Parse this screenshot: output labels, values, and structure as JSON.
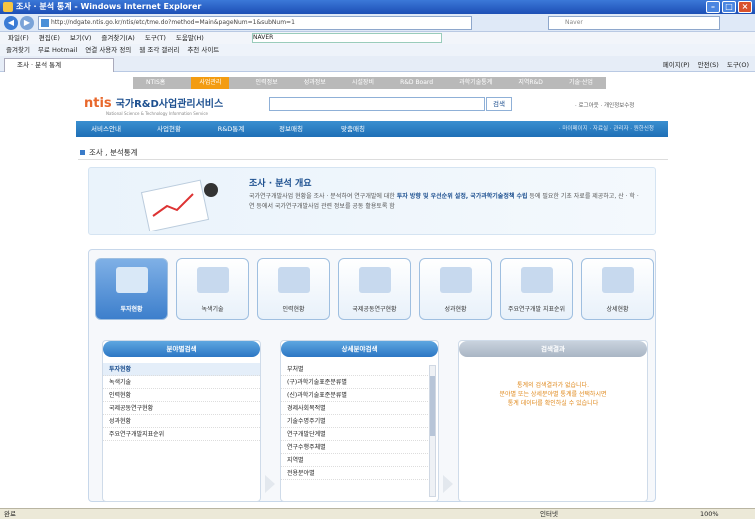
{
  "window": {
    "title": "조사 · 분석 통계 - Windows Internet Explorer"
  },
  "browser": {
    "url": "http://ndgate.ntis.go.kr/ntis/etc/tme.do?method=Main&pageNum=1&subNum=1",
    "search_placeholder": "Naver",
    "menu": [
      "파일(F)",
      "편집(E)",
      "보기(V)",
      "즐겨찾기(A)",
      "도구(T)",
      "도움말(H)"
    ],
    "zum_box": "NAVER",
    "fav_items": [
      "즐겨찾기",
      "무료 Hotmail",
      "연결 사용자 정의",
      "웹 조각 갤러리",
      "추천 사이트"
    ],
    "tab_title": "조사 · 분석 통계",
    "right_tools": [
      "페이지(P)",
      "안전(S)",
      "도구(O)"
    ],
    "status": "완료",
    "zone": "인터넷",
    "zoom": "100%"
  },
  "site": {
    "top_menu": [
      "NTIS홈",
      "사업관리",
      "인력정보",
      "성과정보",
      "시설장비",
      "R&D Board",
      "과학기술통계",
      "지역R&D",
      "기술·산업"
    ],
    "logo": "국가R&D사업관리서비스",
    "logo_sub": "National Science & Technology Information Service",
    "search_button": "검색",
    "util_links": "· 로그아웃 · 개인정보수정",
    "gnb": [
      "서비스안내",
      "사업현황",
      "R&D통계",
      "정보매칭",
      "맞춤매칭"
    ],
    "gnb_right": "· 마이페이지 · 자료실 · 관리자 · 원한신청",
    "page_title": "조사 , 분석통계",
    "overview_title": "조사 · 분석 개요",
    "overview_text_1": "국가연구개발사업 현황을 조사 · 분석하여 연구개발에 대한",
    "overview_bold": "투자 방향 및 우선순위 설정, 국가과학기술정책 수립",
    "overview_text_2": "등에 필요한 기초 자료를 제공하고, 산 · 학 · 연 등에서 국가연구개발사업 관련 정보를 공동 활용토록 함",
    "cards": [
      "투자현황",
      "녹색기술",
      "인력현황",
      "국제공동연구현황",
      "성과현황",
      "주요연구개발 지표순위",
      "상세현황"
    ],
    "col1_head": "분야별검색",
    "col1_items": [
      "투자현황",
      "녹색기술",
      "인력현황",
      "국제공동연구현황",
      "성과현황",
      "주요연구개발지표순위"
    ],
    "col2_head": "상세분야검색",
    "col2_items": [
      "부처별",
      "(구)과학기술표준분류별",
      "(신)과학기술표준분류별",
      "경제사회목적별",
      "기술수명주기별",
      "연구개발단계별",
      "연구수행주체별",
      "지역별",
      "전용분야별"
    ],
    "col3_head": "검색결과",
    "result_text": [
      "통계의 검색결과가 없습니다.",
      "분야별 또는 상세분야별 통계를 선택하시면",
      "통계 데이터를 확인하실 수 있습니다"
    ]
  }
}
